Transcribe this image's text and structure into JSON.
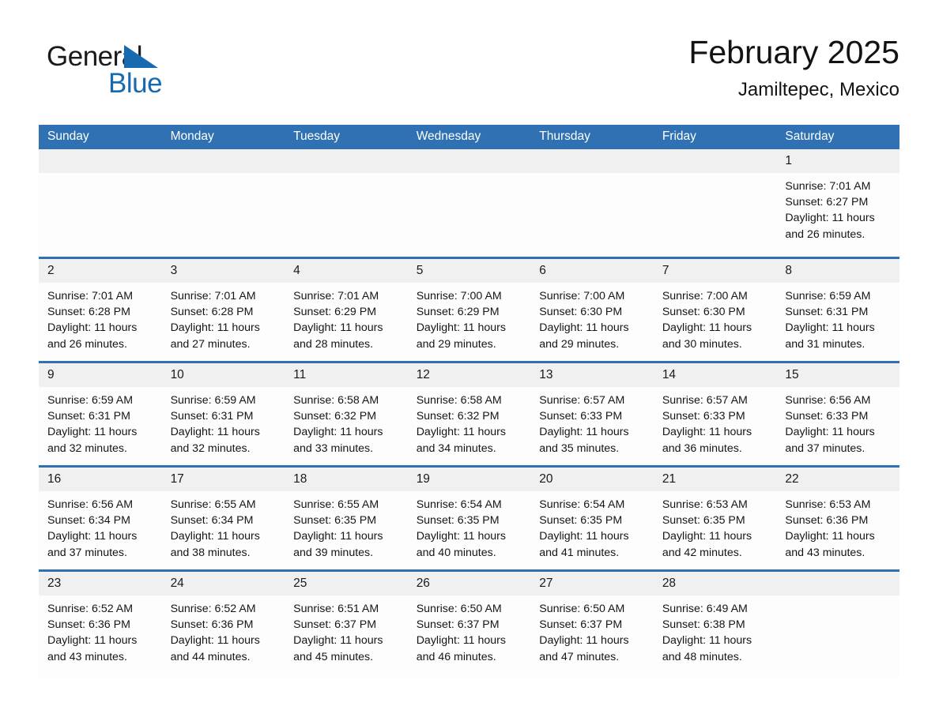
{
  "brand": {
    "line1": "General",
    "line2": "Blue",
    "triangle_color": "#1769b0"
  },
  "header": {
    "title": "February 2025",
    "subtitle": "Jamiltepec, Mexico",
    "accent_color": "#2f71b3",
    "daynum_band_color": "#f0f0f0"
  },
  "calendar": {
    "weekday_headers": [
      "Sunday",
      "Monday",
      "Tuesday",
      "Wednesday",
      "Thursday",
      "Friday",
      "Saturday"
    ],
    "weeks": [
      [
        {
          "day": "",
          "sunrise": "",
          "sunset": "",
          "daylight_1": "",
          "daylight_2": ""
        },
        {
          "day": "",
          "sunrise": "",
          "sunset": "",
          "daylight_1": "",
          "daylight_2": ""
        },
        {
          "day": "",
          "sunrise": "",
          "sunset": "",
          "daylight_1": "",
          "daylight_2": ""
        },
        {
          "day": "",
          "sunrise": "",
          "sunset": "",
          "daylight_1": "",
          "daylight_2": ""
        },
        {
          "day": "",
          "sunrise": "",
          "sunset": "",
          "daylight_1": "",
          "daylight_2": ""
        },
        {
          "day": "",
          "sunrise": "",
          "sunset": "",
          "daylight_1": "",
          "daylight_2": ""
        },
        {
          "day": "1",
          "sunrise": "Sunrise: 7:01 AM",
          "sunset": "Sunset: 6:27 PM",
          "daylight_1": "Daylight: 11 hours",
          "daylight_2": "and 26 minutes."
        }
      ],
      [
        {
          "day": "2",
          "sunrise": "Sunrise: 7:01 AM",
          "sunset": "Sunset: 6:28 PM",
          "daylight_1": "Daylight: 11 hours",
          "daylight_2": "and 26 minutes."
        },
        {
          "day": "3",
          "sunrise": "Sunrise: 7:01 AM",
          "sunset": "Sunset: 6:28 PM",
          "daylight_1": "Daylight: 11 hours",
          "daylight_2": "and 27 minutes."
        },
        {
          "day": "4",
          "sunrise": "Sunrise: 7:01 AM",
          "sunset": "Sunset: 6:29 PM",
          "daylight_1": "Daylight: 11 hours",
          "daylight_2": "and 28 minutes."
        },
        {
          "day": "5",
          "sunrise": "Sunrise: 7:00 AM",
          "sunset": "Sunset: 6:29 PM",
          "daylight_1": "Daylight: 11 hours",
          "daylight_2": "and 29 minutes."
        },
        {
          "day": "6",
          "sunrise": "Sunrise: 7:00 AM",
          "sunset": "Sunset: 6:30 PM",
          "daylight_1": "Daylight: 11 hours",
          "daylight_2": "and 29 minutes."
        },
        {
          "day": "7",
          "sunrise": "Sunrise: 7:00 AM",
          "sunset": "Sunset: 6:30 PM",
          "daylight_1": "Daylight: 11 hours",
          "daylight_2": "and 30 minutes."
        },
        {
          "day": "8",
          "sunrise": "Sunrise: 6:59 AM",
          "sunset": "Sunset: 6:31 PM",
          "daylight_1": "Daylight: 11 hours",
          "daylight_2": "and 31 minutes."
        }
      ],
      [
        {
          "day": "9",
          "sunrise": "Sunrise: 6:59 AM",
          "sunset": "Sunset: 6:31 PM",
          "daylight_1": "Daylight: 11 hours",
          "daylight_2": "and 32 minutes."
        },
        {
          "day": "10",
          "sunrise": "Sunrise: 6:59 AM",
          "sunset": "Sunset: 6:31 PM",
          "daylight_1": "Daylight: 11 hours",
          "daylight_2": "and 32 minutes."
        },
        {
          "day": "11",
          "sunrise": "Sunrise: 6:58 AM",
          "sunset": "Sunset: 6:32 PM",
          "daylight_1": "Daylight: 11 hours",
          "daylight_2": "and 33 minutes."
        },
        {
          "day": "12",
          "sunrise": "Sunrise: 6:58 AM",
          "sunset": "Sunset: 6:32 PM",
          "daylight_1": "Daylight: 11 hours",
          "daylight_2": "and 34 minutes."
        },
        {
          "day": "13",
          "sunrise": "Sunrise: 6:57 AM",
          "sunset": "Sunset: 6:33 PM",
          "daylight_1": "Daylight: 11 hours",
          "daylight_2": "and 35 minutes."
        },
        {
          "day": "14",
          "sunrise": "Sunrise: 6:57 AM",
          "sunset": "Sunset: 6:33 PM",
          "daylight_1": "Daylight: 11 hours",
          "daylight_2": "and 36 minutes."
        },
        {
          "day": "15",
          "sunrise": "Sunrise: 6:56 AM",
          "sunset": "Sunset: 6:33 PM",
          "daylight_1": "Daylight: 11 hours",
          "daylight_2": "and 37 minutes."
        }
      ],
      [
        {
          "day": "16",
          "sunrise": "Sunrise: 6:56 AM",
          "sunset": "Sunset: 6:34 PM",
          "daylight_1": "Daylight: 11 hours",
          "daylight_2": "and 37 minutes."
        },
        {
          "day": "17",
          "sunrise": "Sunrise: 6:55 AM",
          "sunset": "Sunset: 6:34 PM",
          "daylight_1": "Daylight: 11 hours",
          "daylight_2": "and 38 minutes."
        },
        {
          "day": "18",
          "sunrise": "Sunrise: 6:55 AM",
          "sunset": "Sunset: 6:35 PM",
          "daylight_1": "Daylight: 11 hours",
          "daylight_2": "and 39 minutes."
        },
        {
          "day": "19",
          "sunrise": "Sunrise: 6:54 AM",
          "sunset": "Sunset: 6:35 PM",
          "daylight_1": "Daylight: 11 hours",
          "daylight_2": "and 40 minutes."
        },
        {
          "day": "20",
          "sunrise": "Sunrise: 6:54 AM",
          "sunset": "Sunset: 6:35 PM",
          "daylight_1": "Daylight: 11 hours",
          "daylight_2": "and 41 minutes."
        },
        {
          "day": "21",
          "sunrise": "Sunrise: 6:53 AM",
          "sunset": "Sunset: 6:35 PM",
          "daylight_1": "Daylight: 11 hours",
          "daylight_2": "and 42 minutes."
        },
        {
          "day": "22",
          "sunrise": "Sunrise: 6:53 AM",
          "sunset": "Sunset: 6:36 PM",
          "daylight_1": "Daylight: 11 hours",
          "daylight_2": "and 43 minutes."
        }
      ],
      [
        {
          "day": "23",
          "sunrise": "Sunrise: 6:52 AM",
          "sunset": "Sunset: 6:36 PM",
          "daylight_1": "Daylight: 11 hours",
          "daylight_2": "and 43 minutes."
        },
        {
          "day": "24",
          "sunrise": "Sunrise: 6:52 AM",
          "sunset": "Sunset: 6:36 PM",
          "daylight_1": "Daylight: 11 hours",
          "daylight_2": "and 44 minutes."
        },
        {
          "day": "25",
          "sunrise": "Sunrise: 6:51 AM",
          "sunset": "Sunset: 6:37 PM",
          "daylight_1": "Daylight: 11 hours",
          "daylight_2": "and 45 minutes."
        },
        {
          "day": "26",
          "sunrise": "Sunrise: 6:50 AM",
          "sunset": "Sunset: 6:37 PM",
          "daylight_1": "Daylight: 11 hours",
          "daylight_2": "and 46 minutes."
        },
        {
          "day": "27",
          "sunrise": "Sunrise: 6:50 AM",
          "sunset": "Sunset: 6:37 PM",
          "daylight_1": "Daylight: 11 hours",
          "daylight_2": "and 47 minutes."
        },
        {
          "day": "28",
          "sunrise": "Sunrise: 6:49 AM",
          "sunset": "Sunset: 6:38 PM",
          "daylight_1": "Daylight: 11 hours",
          "daylight_2": "and 48 minutes."
        },
        {
          "day": "",
          "sunrise": "",
          "sunset": "",
          "daylight_1": "",
          "daylight_2": ""
        }
      ]
    ]
  }
}
